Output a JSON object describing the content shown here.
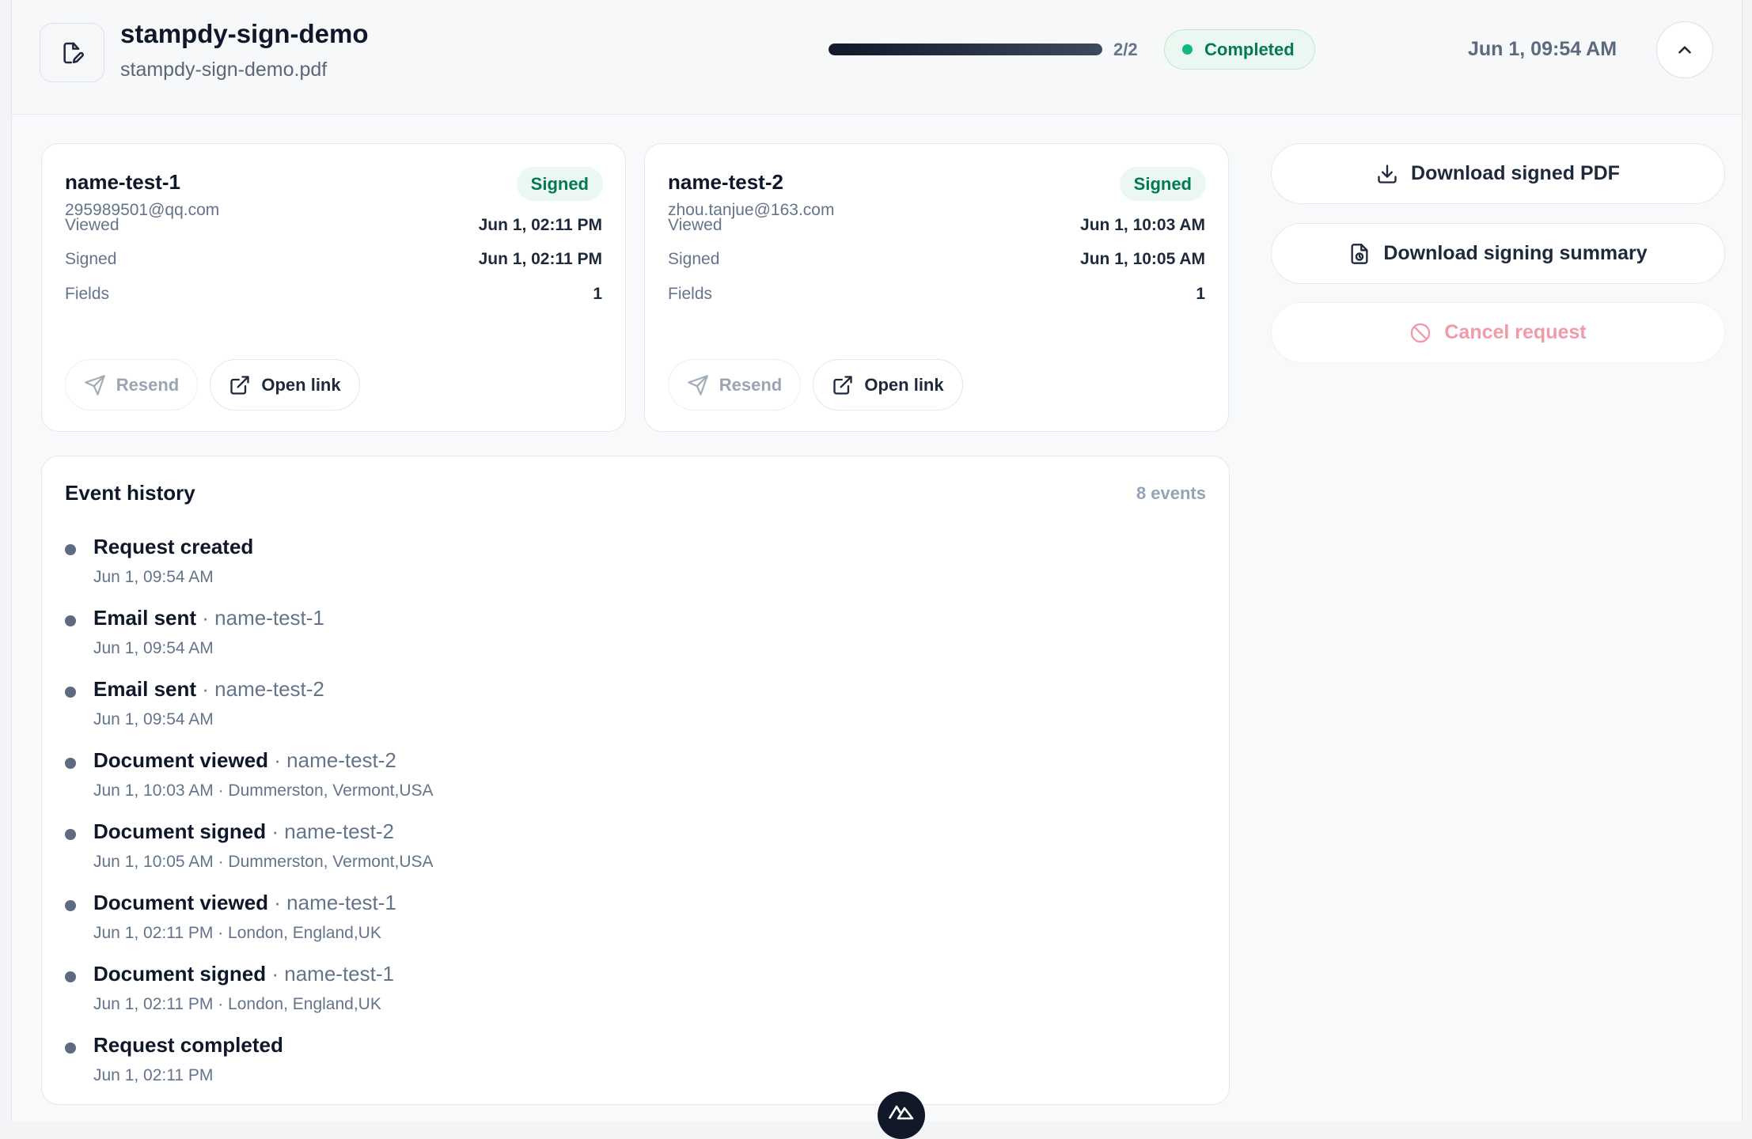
{
  "header": {
    "title": "stampdy-sign-demo",
    "filename": "stampdy-sign-demo.pdf",
    "progress_text": "2/2",
    "progress_fraction": 1.0,
    "status": "Completed",
    "date": "Jun 1, 09:54 AM",
    "icons": {
      "document": "file-edit-icon",
      "collapse": "chevron-up-icon"
    }
  },
  "colors": {
    "accent_dark": "#111827",
    "success": "#10b981",
    "success_text": "#047857",
    "danger_muted": "#f19aa8"
  },
  "signers": [
    {
      "name": "name-test-1",
      "email": "295989501@qq.com",
      "badge": "Signed",
      "viewed_label": "Viewed",
      "viewed": "Jun 1, 02:11 PM",
      "signed_label": "Signed",
      "signed": "Jun 1, 02:11 PM",
      "fields_label": "Fields",
      "fields": "1",
      "resend_label": "Resend",
      "open_link_label": "Open link"
    },
    {
      "name": "name-test-2",
      "email": "zhou.tanjue@163.com",
      "badge": "Signed",
      "viewed_label": "Viewed",
      "viewed": "Jun 1, 10:03 AM",
      "signed_label": "Signed",
      "signed": "Jun 1, 10:05 AM",
      "fields_label": "Fields",
      "fields": "1",
      "resend_label": "Resend",
      "open_link_label": "Open link"
    }
  ],
  "actions": {
    "download_pdf": "Download signed PDF",
    "download_summary": "Download signing summary",
    "cancel": "Cancel request"
  },
  "history": {
    "title": "Event history",
    "count": "8 events",
    "events": [
      {
        "title": "Request created",
        "actor": "",
        "meta": "Jun 1, 09:54 AM"
      },
      {
        "title": "Email sent",
        "actor": "name-test-1",
        "meta": "Jun 1, 09:54 AM"
      },
      {
        "title": "Email sent",
        "actor": "name-test-2",
        "meta": "Jun 1, 09:54 AM"
      },
      {
        "title": "Document viewed",
        "actor": "name-test-2",
        "meta": "Jun 1, 10:03 AM · Dummerston, Vermont,USA"
      },
      {
        "title": "Document signed",
        "actor": "name-test-2",
        "meta": "Jun 1, 10:05 AM · Dummerston, Vermont,USA"
      },
      {
        "title": "Document viewed",
        "actor": "name-test-1",
        "meta": "Jun 1, 02:11 PM · London, England,UK"
      },
      {
        "title": "Document signed",
        "actor": "name-test-1",
        "meta": "Jun 1, 02:11 PM · London, England,UK"
      },
      {
        "title": "Request completed",
        "actor": "",
        "meta": "Jun 1, 02:11 PM"
      }
    ]
  }
}
